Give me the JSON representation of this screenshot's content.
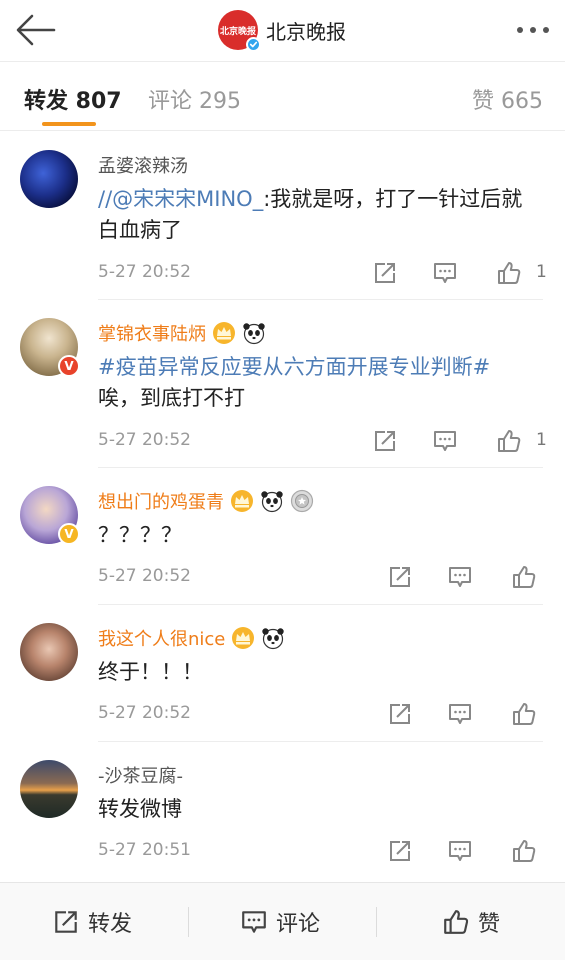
{
  "header": {
    "account_name": "北京晚报",
    "logo_text": "北京晚报"
  },
  "tabs": {
    "repost": "转发 807",
    "comment": "评论 295",
    "like": "赞 665"
  },
  "items": [
    {
      "username": "孟婆滚辣汤",
      "mention": "//@宋宋宋MINO_",
      "text": ":我就是呀，打了一针过后就白血病了",
      "time": "5-27 20:52",
      "likes": "1"
    },
    {
      "username": "掌锦衣事陆炳",
      "topic": "#疫苗异常反应要从六方面开展专业判断#",
      "text": "唉，到底打不打",
      "time": "5-27 20:52",
      "likes": "1"
    },
    {
      "username": "想出门的鸡蛋青",
      "text": "？？？？",
      "time": "5-27 20:52",
      "likes": ""
    },
    {
      "username": "我这个人很nice",
      "text": "终于！！！",
      "time": "5-27 20:52",
      "likes": ""
    },
    {
      "username": "-沙茶豆腐-",
      "text": "转发微博",
      "time": "5-27 20:51",
      "likes": ""
    }
  ],
  "bottom_bar": {
    "repost": "转发",
    "comment": "评论",
    "like": "赞"
  },
  "colors": {
    "accent": "#f2941c",
    "link": "#4d7cb6",
    "vip_name": "#ef7d19"
  }
}
